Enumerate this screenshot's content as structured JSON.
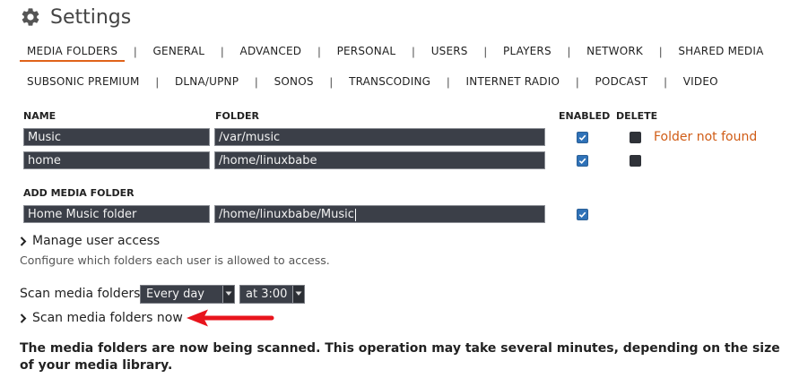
{
  "header": {
    "title": "Settings",
    "icon": "gear-icon"
  },
  "tabs_row1": [
    {
      "label": "MEDIA FOLDERS",
      "active": true
    },
    {
      "label": "GENERAL"
    },
    {
      "label": "ADVANCED"
    },
    {
      "label": "PERSONAL"
    },
    {
      "label": "USERS"
    },
    {
      "label": "PLAYERS"
    },
    {
      "label": "NETWORK"
    },
    {
      "label": "SHARED MEDIA"
    }
  ],
  "tabs_row2": [
    {
      "label": "SUBSONIC PREMIUM"
    },
    {
      "label": "DLNA/UPNP"
    },
    {
      "label": "SONOS"
    },
    {
      "label": "TRANSCODING"
    },
    {
      "label": "INTERNET RADIO"
    },
    {
      "label": "PODCAST"
    },
    {
      "label": "VIDEO"
    }
  ],
  "tab_separator": "|",
  "table": {
    "headers": {
      "name": "NAME",
      "folder": "FOLDER",
      "enabled": "ENABLED",
      "delete": "DELETE"
    },
    "rows": [
      {
        "name": "Music",
        "folder": "/var/music",
        "enabled": true,
        "delete": false,
        "warning": "Folder not found"
      },
      {
        "name": "home",
        "folder": "/home/linuxbabe",
        "enabled": true,
        "delete": false,
        "warning": ""
      }
    ]
  },
  "add_folder": {
    "heading": "ADD MEDIA FOLDER",
    "name": "Home Music folder",
    "folder": "/home/linuxbabe/Music",
    "enabled": true
  },
  "manage_access": {
    "link": "Manage user access",
    "description": "Configure which folders each user is allowed to access."
  },
  "scan": {
    "label": "Scan media folders",
    "interval": "Every day",
    "time": "at 3:00",
    "now_link": "Scan media folders now",
    "message": "The media folders are now being scanned. This operation may take several minutes, depending on the size of your media library."
  },
  "colors": {
    "accent": "#e0631a",
    "warning": "#d05c16",
    "field_bg": "#3b3f48",
    "checkbox_on": "#2f72b8",
    "annotation_arrow": "#e8141c"
  }
}
